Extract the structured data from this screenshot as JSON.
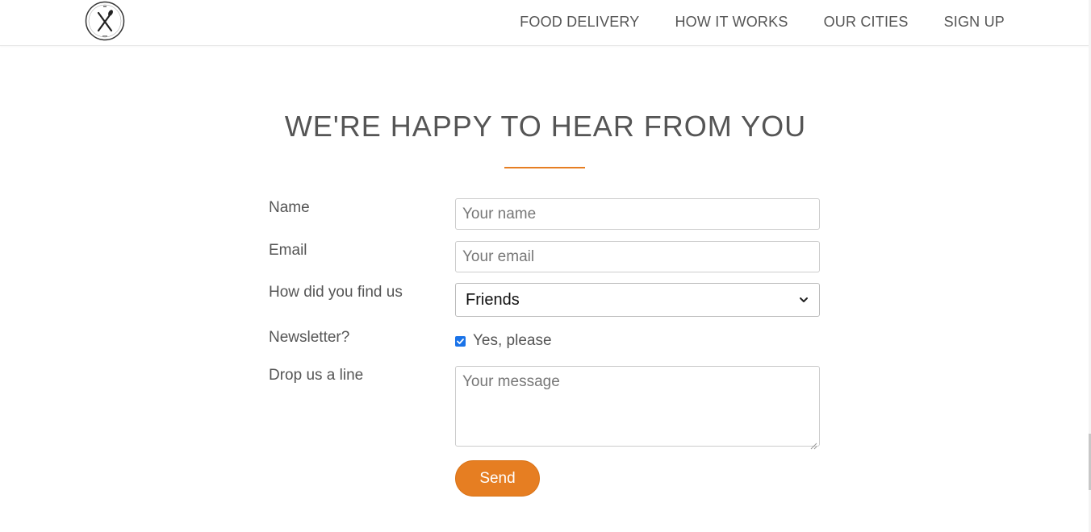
{
  "header": {
    "nav": [
      {
        "label": "FOOD DELIVERY"
      },
      {
        "label": "HOW IT WORKS"
      },
      {
        "label": "OUR CITIES"
      },
      {
        "label": "SIGN UP"
      }
    ]
  },
  "main": {
    "heading": "WE'RE HAPPY TO HEAR FROM YOU",
    "form": {
      "name_label": "Name",
      "name_placeholder": "Your name",
      "email_label": "Email",
      "email_placeholder": "Your email",
      "find_label": "How did you find us",
      "find_selected": "Friends",
      "newsletter_label": "Newsletter?",
      "newsletter_checked": true,
      "newsletter_option": "Yes, please",
      "message_label": "Drop us a line",
      "message_placeholder": "Your message",
      "send_label": "Send"
    }
  },
  "colors": {
    "accent": "#e67e22",
    "text": "#555555",
    "checkbox": "#1a73e8"
  },
  "icons": {
    "logo": "fork-knife-logo-icon",
    "select": "chevron-down-icon",
    "check": "checkmark-icon"
  }
}
